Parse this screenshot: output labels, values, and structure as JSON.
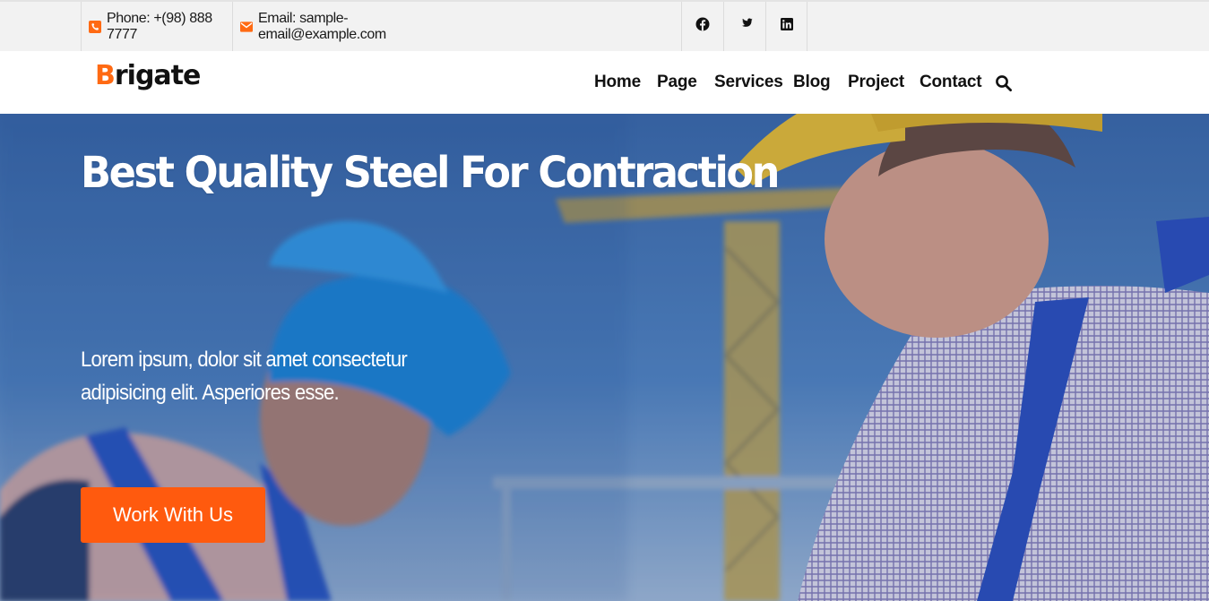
{
  "topbar": {
    "phone": "Phone: +(98) 888 7777",
    "email": "Email: sample-email@example.com",
    "social": [
      "facebook-icon",
      "twitter-icon",
      "linkedin-icon"
    ]
  },
  "brand": {
    "first_letter": "B",
    "rest": "rigate",
    "accent_color": "#ff6a13"
  },
  "nav": {
    "items": [
      "Home",
      "Page",
      "Services",
      "Blog",
      "Project",
      "Contact"
    ],
    "search_icon": "search-icon"
  },
  "hero": {
    "title": "Best Quality Steel For Contraction",
    "subtitle": "Lorem ipsum, dolor sit amet consectetur adipisicing elit. Asperiores esse.",
    "cta_label": "Work With Us",
    "cta_color": "#ff5a0e"
  }
}
